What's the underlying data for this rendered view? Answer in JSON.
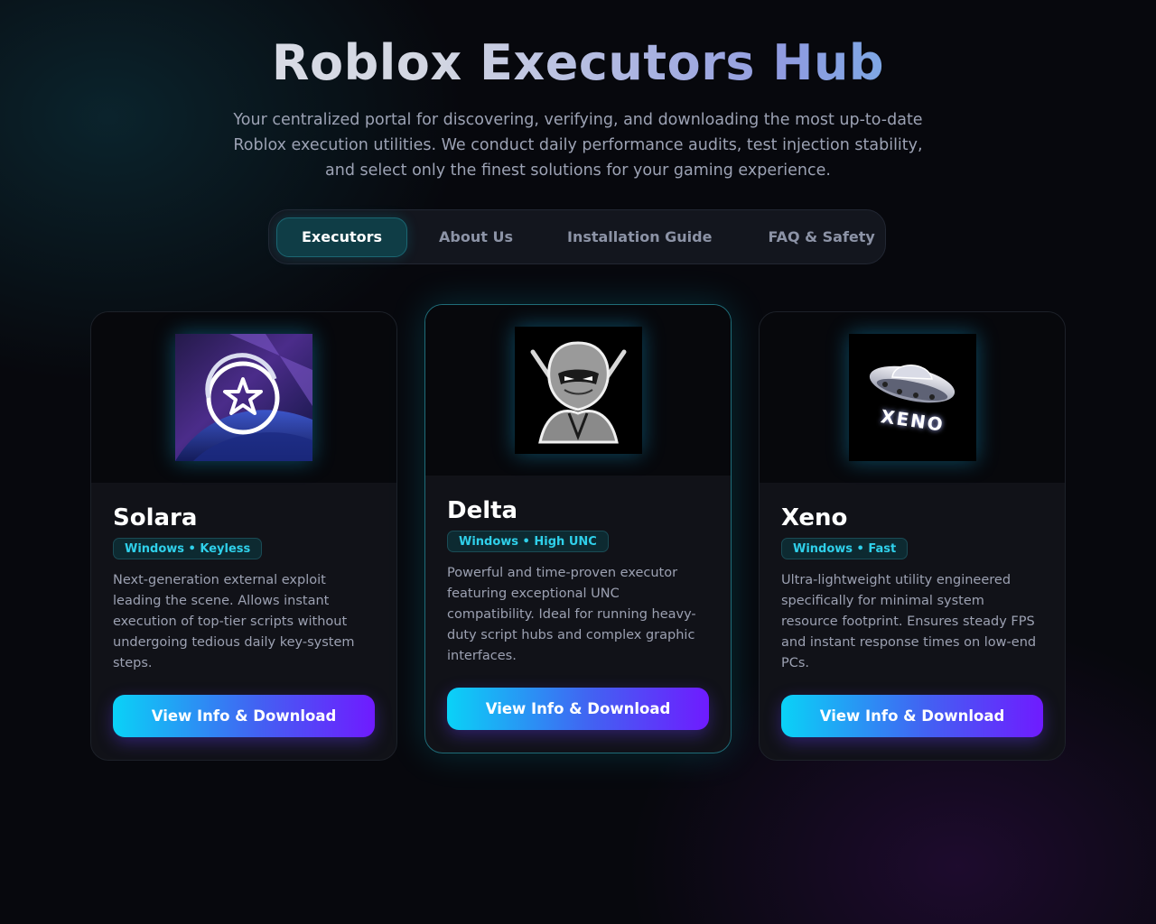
{
  "hero": {
    "title": "Roblox Executors Hub",
    "subtitle": "Your centralized portal for discovering, verifying, and downloading the most up-to-date Roblox execution utilities. We conduct daily performance audits, test injection stability, and select only the finest solutions for your gaming experience."
  },
  "tabs": [
    {
      "label": "Executors",
      "active": true
    },
    {
      "label": "About Us",
      "active": false
    },
    {
      "label": "Installation Guide",
      "active": false
    },
    {
      "label": "FAQ & Safety",
      "active": false
    }
  ],
  "cards": [
    {
      "name": "Solara",
      "badge": "Windows • Keyless",
      "description": "Next-generation external exploit leading the scene. Allows instant execution of top-tier scripts without undergoing tedious daily key-system steps.",
      "button": "View Info & Download",
      "icon": "star-circle-icon",
      "featured": false
    },
    {
      "name": "Delta",
      "badge": "Windows • High UNC",
      "description": "Powerful and time-proven executor featuring exceptional UNC compatibility. Ideal for running heavy-duty script hubs and complex graphic interfaces.",
      "button": "View Info & Download",
      "icon": "ninja-icon",
      "featured": true
    },
    {
      "name": "Xeno",
      "badge": "Windows • Fast",
      "description": "Ultra-lightweight utility engineered specifically for minimal system resource footprint. Ensures steady FPS and instant response times on low-end PCs.",
      "button": "View Info & Download",
      "icon": "ufo-icon",
      "logo_text": "XENO",
      "featured": false
    }
  ],
  "colors": {
    "accent_cyan": "#0ad2f7",
    "accent_purple": "#6f1bff",
    "badge_text": "#2fd0ea",
    "background": "#07080d"
  }
}
